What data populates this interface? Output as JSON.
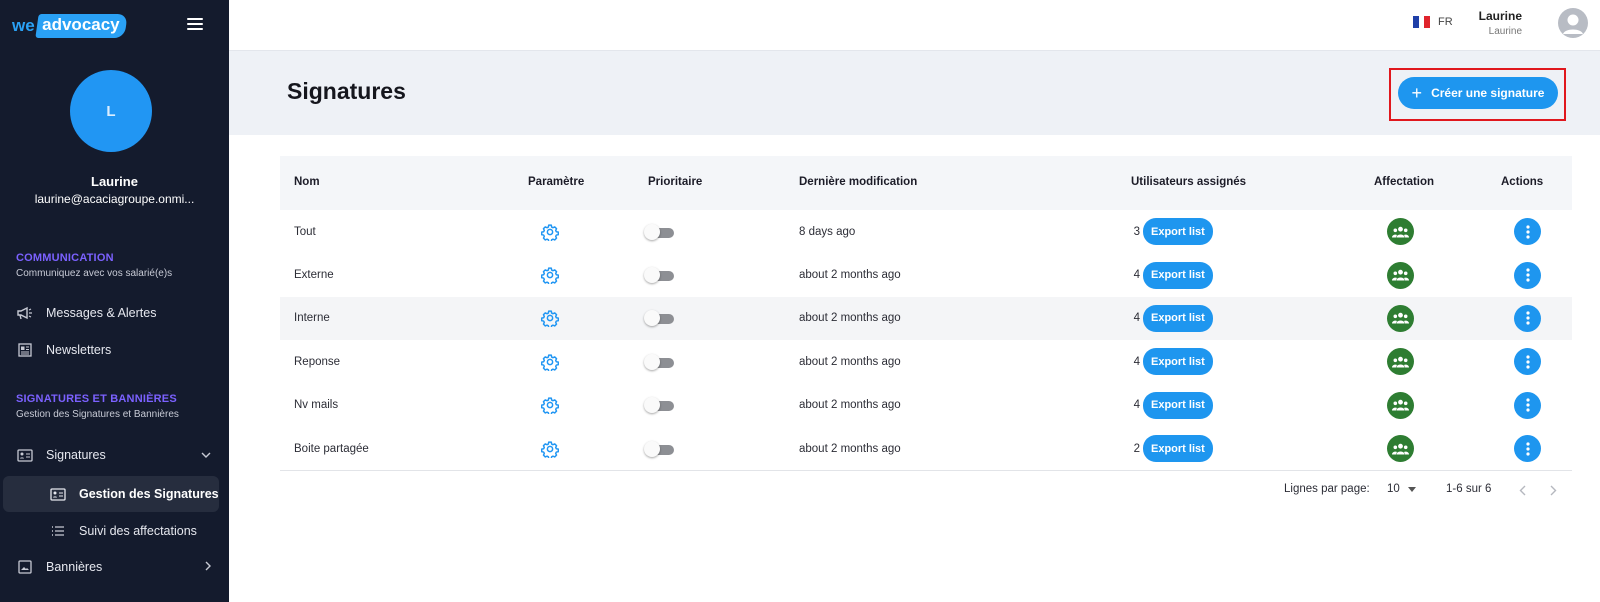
{
  "brand": {
    "we": "we",
    "advocacy": "advocacy"
  },
  "sidebar": {
    "avatar_initial": "L",
    "user_name": "Laurine",
    "user_email": "laurine@acaciagroupe.onmi...",
    "sections": [
      {
        "title": "COMMUNICATION",
        "subtitle": "Communiquez avec vos salarié(e)s"
      },
      {
        "title": "SIGNATURES ET BANNIÈRES",
        "subtitle": "Gestion des Signatures et Bannières"
      }
    ],
    "items": [
      {
        "label": "Messages & Alertes"
      },
      {
        "label": "Newsletters"
      },
      {
        "label": "Signatures"
      },
      {
        "label": "Gestion des Signatures"
      },
      {
        "label": "Suivi des affectations"
      },
      {
        "label": "Bannières"
      }
    ]
  },
  "topbar": {
    "lang": "FR",
    "user_name": "Laurine",
    "user_sub": "Laurine"
  },
  "page": {
    "title": "Signatures",
    "create_label": "Créer une signature"
  },
  "table": {
    "headers": {
      "name": "Nom",
      "param": "Paramètre",
      "priority": "Prioritaire",
      "modified": "Dernière modification",
      "users": "Utilisateurs assignés",
      "affect": "Affectation",
      "actions": "Actions"
    },
    "export_label": "Export list",
    "rows": [
      {
        "name": "Tout",
        "modified": "8 days ago",
        "count": "3",
        "prioritaire": false
      },
      {
        "name": "Externe",
        "modified": "about 2 months ago",
        "count": "4",
        "prioritaire": false
      },
      {
        "name": "Interne",
        "modified": "about 2 months ago",
        "count": "4",
        "prioritaire": false
      },
      {
        "name": "Reponse",
        "modified": "about 2 months ago",
        "count": "4",
        "prioritaire": false
      },
      {
        "name": "Nv mails",
        "modified": "about 2 months ago",
        "count": "4",
        "prioritaire": false
      },
      {
        "name": "Boite partagée",
        "modified": "about 2 months ago",
        "count": "2",
        "prioritaire": false
      }
    ]
  },
  "pagination": {
    "rows_label": "Lignes par page:",
    "rows_value": "10",
    "range": "1-6 sur 6"
  },
  "colors": {
    "sidebar_bg": "#141b2d",
    "accent_blue": "#1e96ef",
    "section_purple": "#7b61ff",
    "affect_green": "#2e7d32",
    "highlight_red": "#e0171d"
  }
}
